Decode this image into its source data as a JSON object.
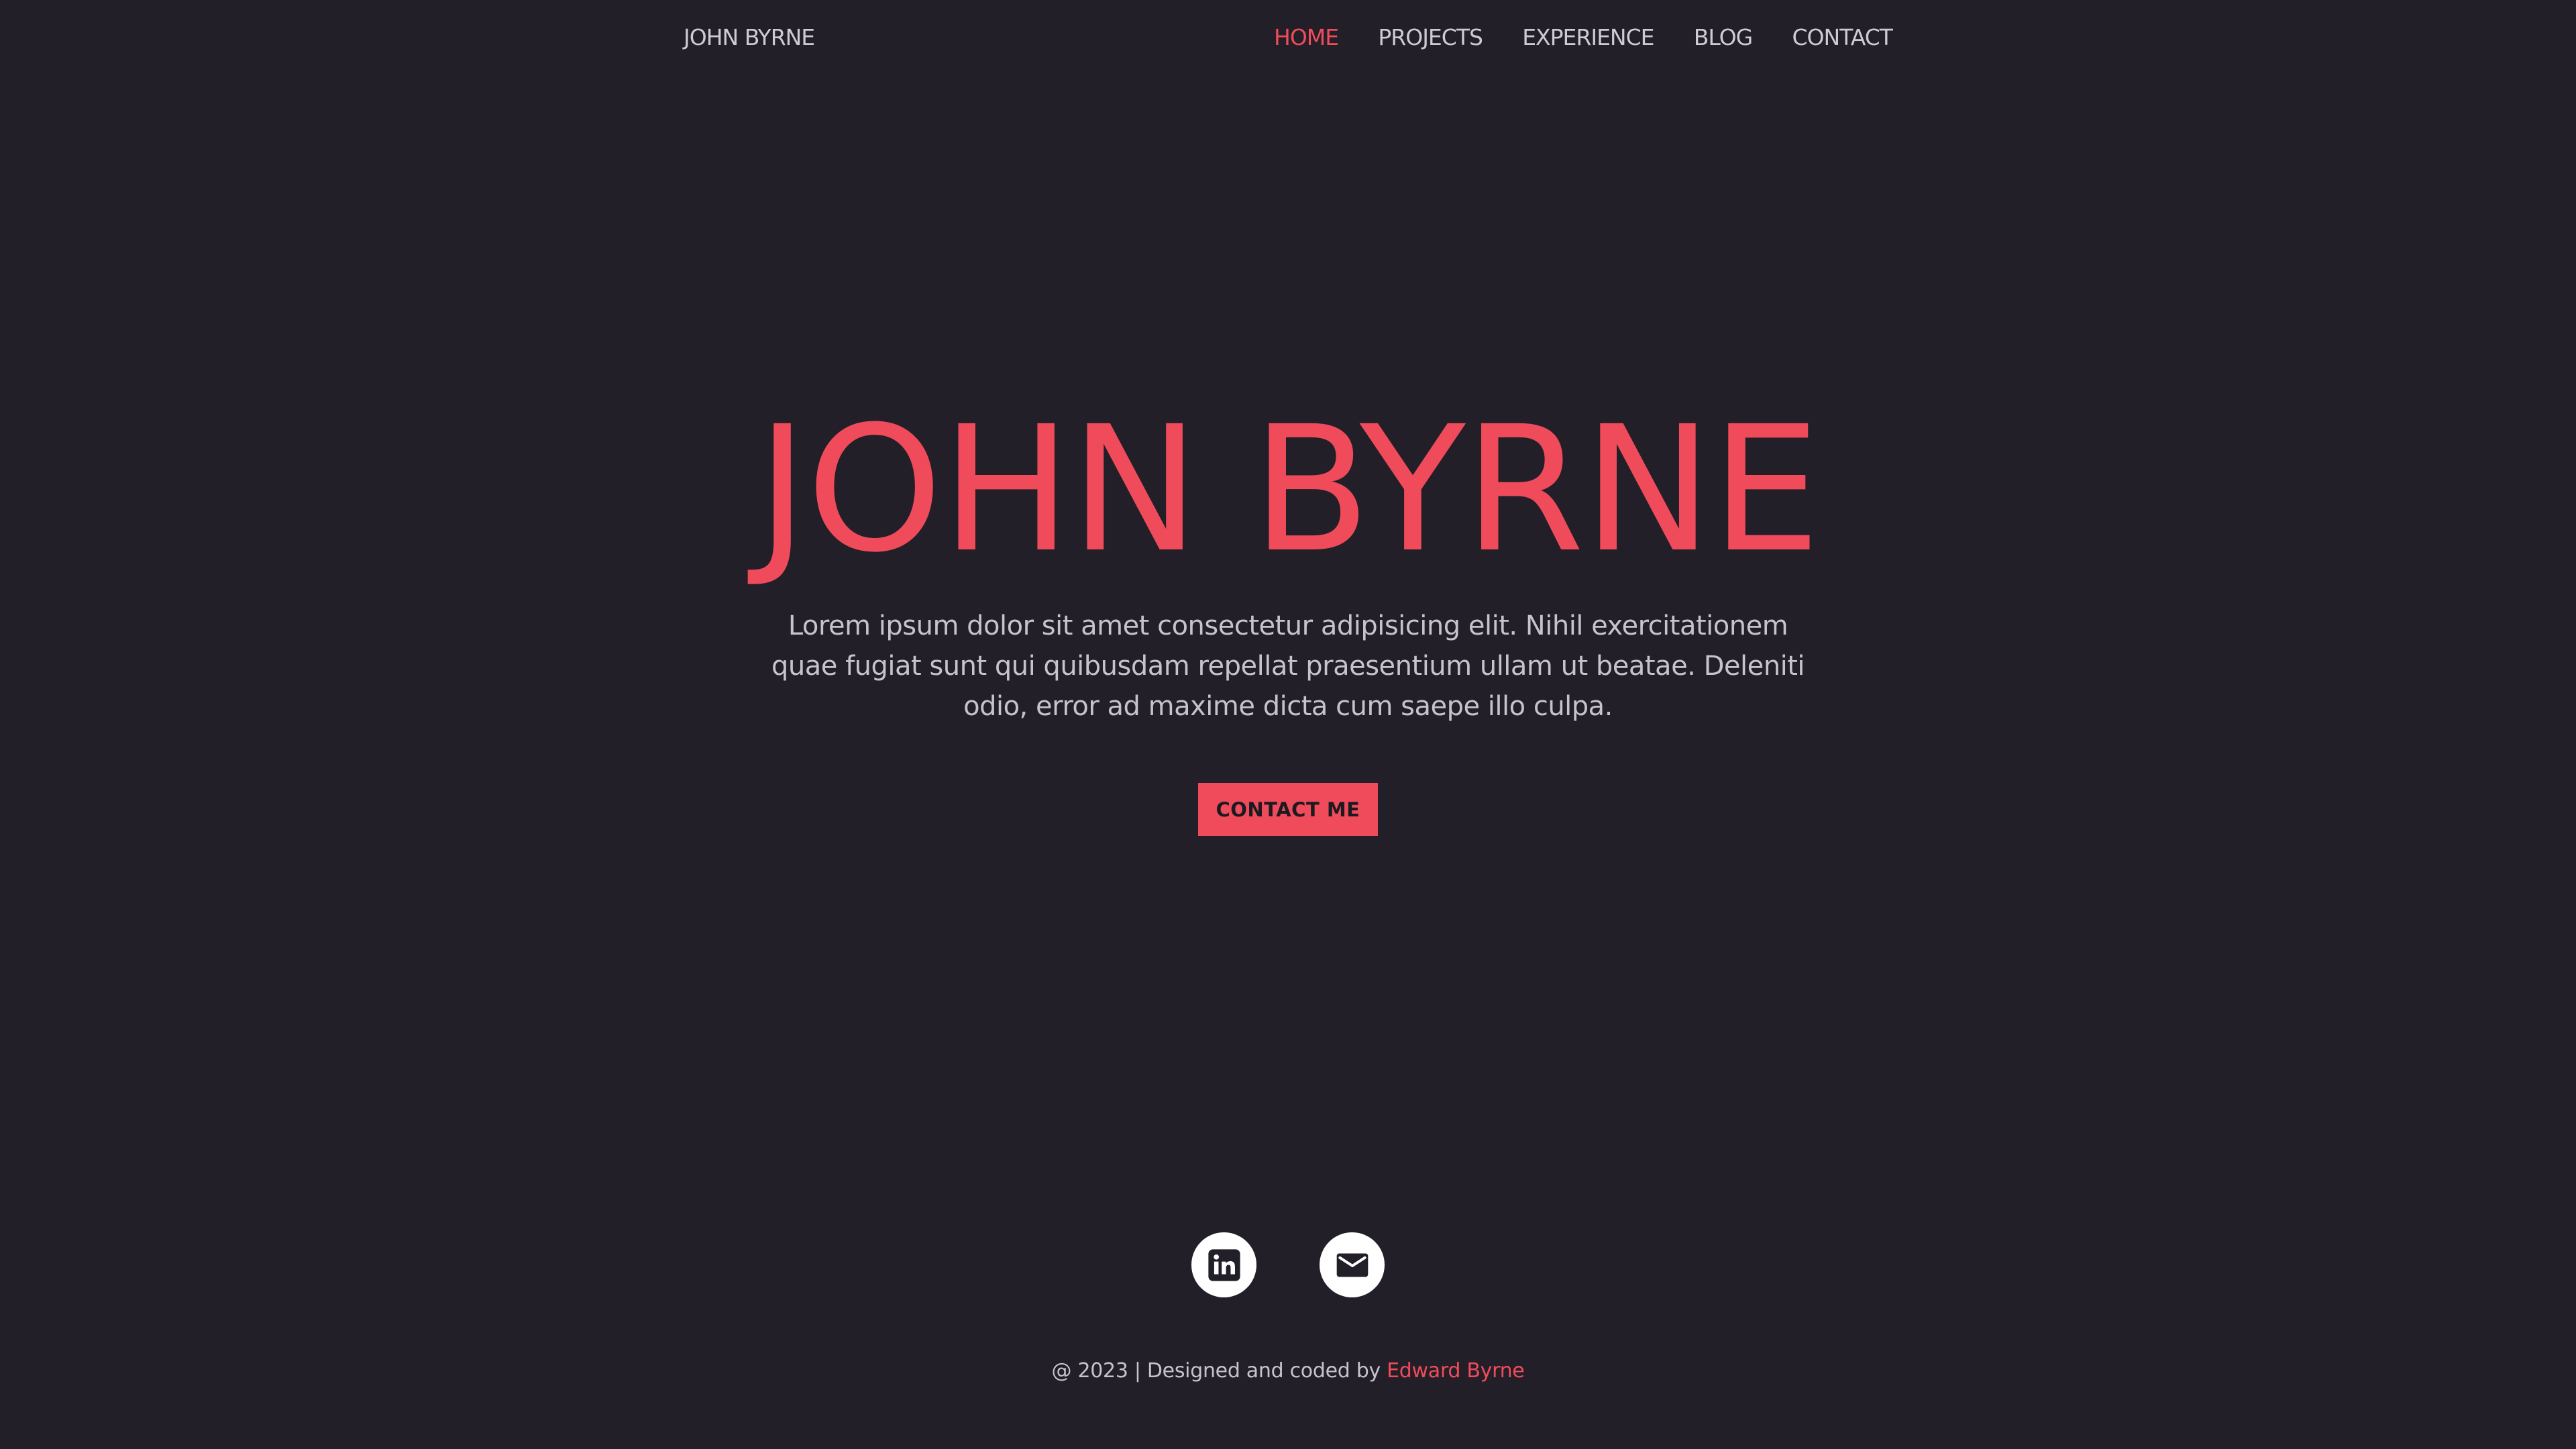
{
  "header": {
    "brand": "JOHN BYRNE",
    "nav": [
      {
        "label": "HOME",
        "active": true
      },
      {
        "label": "PROJECTS",
        "active": false
      },
      {
        "label": "EXPERIENCE",
        "active": false
      },
      {
        "label": "BLOG",
        "active": false
      },
      {
        "label": "CONTACT",
        "active": false
      }
    ]
  },
  "hero": {
    "title": "JOHN BYRNE",
    "description": "Lorem ipsum dolor sit amet consectetur adipisicing elit. Nihil exercitationem quae fugiat sunt qui quibusdam repellat praesentium ullam ut beatae. Deleniti odio, error ad maxime dicta cum saepe illo culpa.",
    "cta_label": "CONTACT ME"
  },
  "socials": [
    {
      "icon": "linkedin-icon"
    },
    {
      "icon": "email-icon"
    }
  ],
  "footer": {
    "text": "@ 2023 | Designed and coded by",
    "author": "Edward Byrne"
  },
  "colors": {
    "background": "#221f28",
    "accent": "#f04b5b",
    "text": "#c9c7cf",
    "icon_background": "#ffffff",
    "icon_foreground": "#221f28"
  }
}
